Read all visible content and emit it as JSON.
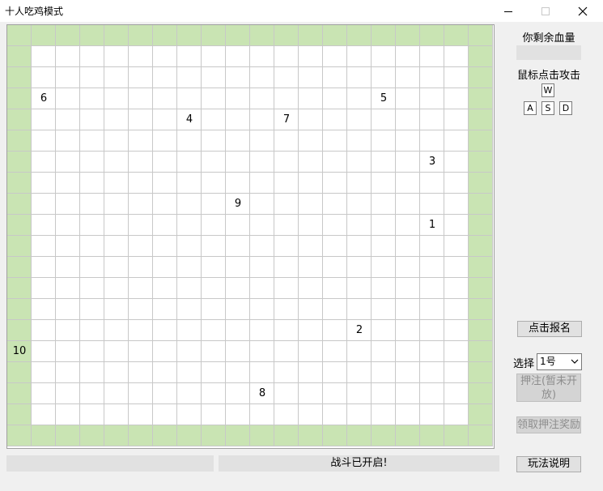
{
  "window": {
    "title": "十人吃鸡模式"
  },
  "board": {
    "cols": 20,
    "rows": 20,
    "wall_color": "#c9e4b3",
    "players": [
      {
        "label": "6",
        "col": 1,
        "row": 3
      },
      {
        "label": "5",
        "col": 15,
        "row": 3
      },
      {
        "label": "4",
        "col": 7,
        "row": 4
      },
      {
        "label": "7",
        "col": 11,
        "row": 4
      },
      {
        "label": "3",
        "col": 17,
        "row": 6
      },
      {
        "label": "9",
        "col": 9,
        "row": 8
      },
      {
        "label": "1",
        "col": 17,
        "row": 9
      },
      {
        "label": "2",
        "col": 14,
        "row": 14
      },
      {
        "label": "10",
        "col": 0,
        "row": 15
      },
      {
        "label": "8",
        "col": 10,
        "row": 17
      }
    ]
  },
  "panel": {
    "hp_label": "你剩余血量",
    "hp_value": "",
    "attack_label": "鼠标点击攻击",
    "keys": {
      "up": "W",
      "left": "A",
      "down": "S",
      "right": "D"
    },
    "signup_button": "点击报名",
    "select_label": "选择",
    "select_value": "1号",
    "bet_button": "押注(暂未开放)",
    "claim_button": "领取押注奖励",
    "help_button": "玩法说明"
  },
  "status": {
    "left": "",
    "right": "战斗已开启!"
  }
}
